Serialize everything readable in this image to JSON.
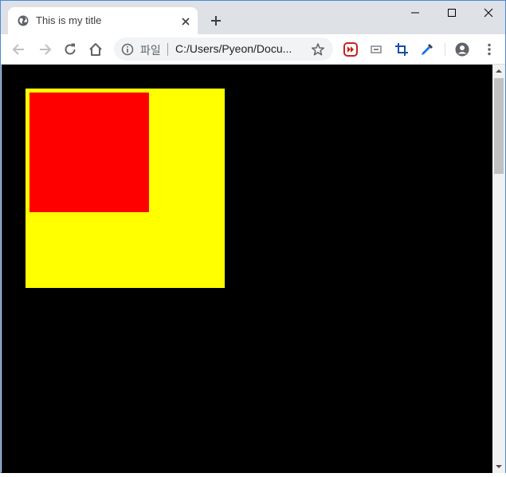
{
  "tab": {
    "title": "This is my title",
    "favicon": "globe-icon",
    "close_icon": "close-icon"
  },
  "window_controls": {
    "minimize_icon": "minimize-icon",
    "maximize_icon": "maximize-icon",
    "close_icon": "window-close-icon"
  },
  "toolbar": {
    "back_icon": "back-arrow-icon",
    "forward_icon": "forward-arrow-icon",
    "reload_icon": "reload-icon",
    "home_icon": "home-icon",
    "extensions": [
      "media-extension-icon",
      "screen-extension-icon",
      "crop-extension-icon",
      "eyedropper-extension-icon"
    ],
    "profile_icon": "profile-icon",
    "menu_icon": "kebab-menu-icon"
  },
  "omnibox": {
    "scheme_label": "파일",
    "url": "C:/Users/Pyeon/Docu...",
    "info_icon": "info-icon",
    "bookmark_icon": "star-icon"
  },
  "page": {
    "background": "#000000",
    "outer_box_color": "#ffff00",
    "inner_box_color": "#ff0000"
  },
  "colors": {
    "tab_strip": "#dee1e6",
    "window_border": "#4a8ad6",
    "omnibox_bg": "#f1f3f4"
  }
}
